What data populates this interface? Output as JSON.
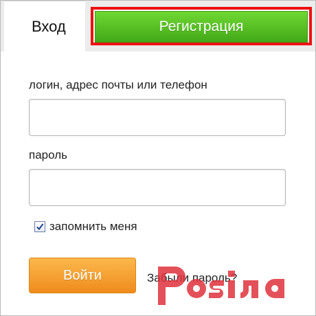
{
  "tabs": {
    "login_label": "Вход",
    "register_label": "Регистрация"
  },
  "form": {
    "login_field_label": "логин, адрес почты или телефон",
    "login_value": "",
    "password_field_label": "пароль",
    "password_value": "",
    "remember_label": "запомнить меня",
    "remember_checked": true,
    "submit_label": "Войти",
    "forgot_label": "Забыли пароль?"
  },
  "colors": {
    "register_green": "#4db81f",
    "highlight_red": "#ee1111",
    "submit_orange": "#f39a2a",
    "watermark_red": "#e0323d"
  },
  "watermark": {
    "text": "Posiлa"
  }
}
